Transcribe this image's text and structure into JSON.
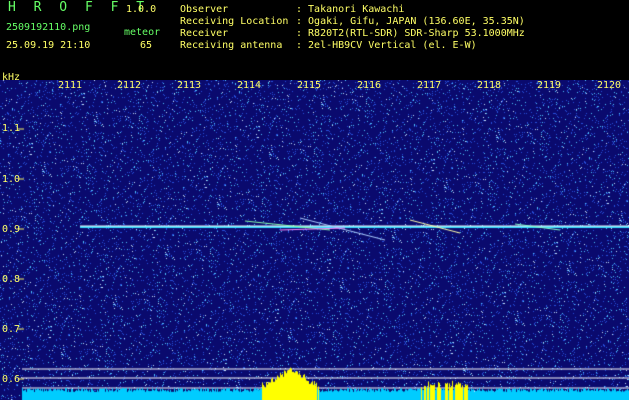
{
  "app": {
    "name": "H R O F F T",
    "version": "1.0.0"
  },
  "file": {
    "name": "2509192110.png",
    "datetime": "25.09.19 21:10"
  },
  "meteor": {
    "label": "meteor",
    "count": "65"
  },
  "info": [
    {
      "label": "Observer",
      "value": ": Takanori Kawachi"
    },
    {
      "label": "Receiving Location",
      "value": ": Ogaki, Gifu, JAPAN (136.60E, 35.35N)"
    },
    {
      "label": "Receiver",
      "value": ": R820T2(RTL-SDR) SDR-Sharp 53.1000MHz"
    },
    {
      "label": "Receiving antenna",
      "value": ": 2el-HB9CV Vertical (el. E-W)"
    }
  ],
  "axis": {
    "unit": "kHz",
    "x_ticks": [
      "2111",
      "2112",
      "2113",
      "2114",
      "2115",
      "2116",
      "2117",
      "2118",
      "2119",
      "2120"
    ],
    "y_ticks": [
      "1.1",
      "1.0",
      "0.9",
      "0.8",
      "0.7",
      "0.6"
    ],
    "y_range": [
      0.58,
      1.18
    ]
  },
  "colors": {
    "bg": "#0a0a6e",
    "text": "#ffff66",
    "title": "#66ff66",
    "carrier": "#33ddff",
    "floor": "#00ccff",
    "peak": "#ffff00"
  }
}
